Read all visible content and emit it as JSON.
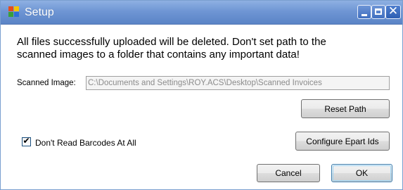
{
  "window": {
    "title": "Setup",
    "icon": "app-window-icon",
    "controls": {
      "minimize_icon": "minimize-icon",
      "maximize_icon": "maximize-icon",
      "close_icon": "close-icon",
      "close_glyph": "✕"
    }
  },
  "message": "All files successfully uploaded  will be deleted.  Don't set path to the\nscanned images to a folder that contains any important data!",
  "scanned_image": {
    "label": "Scanned Image:",
    "value": "C:\\Documents and Settings\\ROY.ACS\\Desktop\\Scanned Invoices",
    "enabled": false
  },
  "buttons": {
    "reset_path": "Reset Path",
    "configure_epart_ids": "Configure Epart Ids",
    "cancel": "Cancel",
    "ok": "OK"
  },
  "checkbox": {
    "label": "Don't Read Barcodes At All",
    "checked": true,
    "mark": "✔"
  },
  "colors": {
    "titlebar": "#6f96d4",
    "title_text": "#ffffff",
    "window_bg": "#ffffff",
    "disabled_text": "#8c8c8c",
    "default_button_border": "#3c7fb1"
  }
}
